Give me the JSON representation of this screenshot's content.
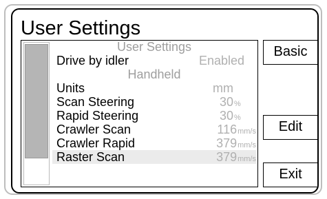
{
  "title": "User Settings",
  "sections": [
    {
      "header": "User Settings"
    },
    {
      "header": "Handheld"
    }
  ],
  "rows": {
    "drive_by_idler": {
      "label": "Drive by idler",
      "value": "Enabled",
      "unit": ""
    },
    "units": {
      "label": "Units",
      "value": "mm",
      "unit": ""
    },
    "scan_steering": {
      "label": "Scan Steering",
      "value": "30",
      "unit": "%"
    },
    "rapid_steering": {
      "label": "Rapid Steering",
      "value": "30",
      "unit": "%"
    },
    "crawler_scan": {
      "label": "Crawler Scan",
      "value": "116",
      "unit": "mm/s"
    },
    "crawler_rapid": {
      "label": "Crawler Rapid",
      "value": "379",
      "unit": "mm/s"
    },
    "raster_scan": {
      "label": "Raster Scan",
      "value": "379",
      "unit": "mm/s"
    }
  },
  "selected_row": "raster_scan",
  "buttons": {
    "basic": "Basic",
    "edit": "Edit",
    "exit": "Exit"
  },
  "colors": {
    "header_text": "#9e9e9e",
    "value_text": "#b0b0b0",
    "selected_bg": "#ebebeb",
    "scroll_thumb": "#b5b5b5"
  }
}
